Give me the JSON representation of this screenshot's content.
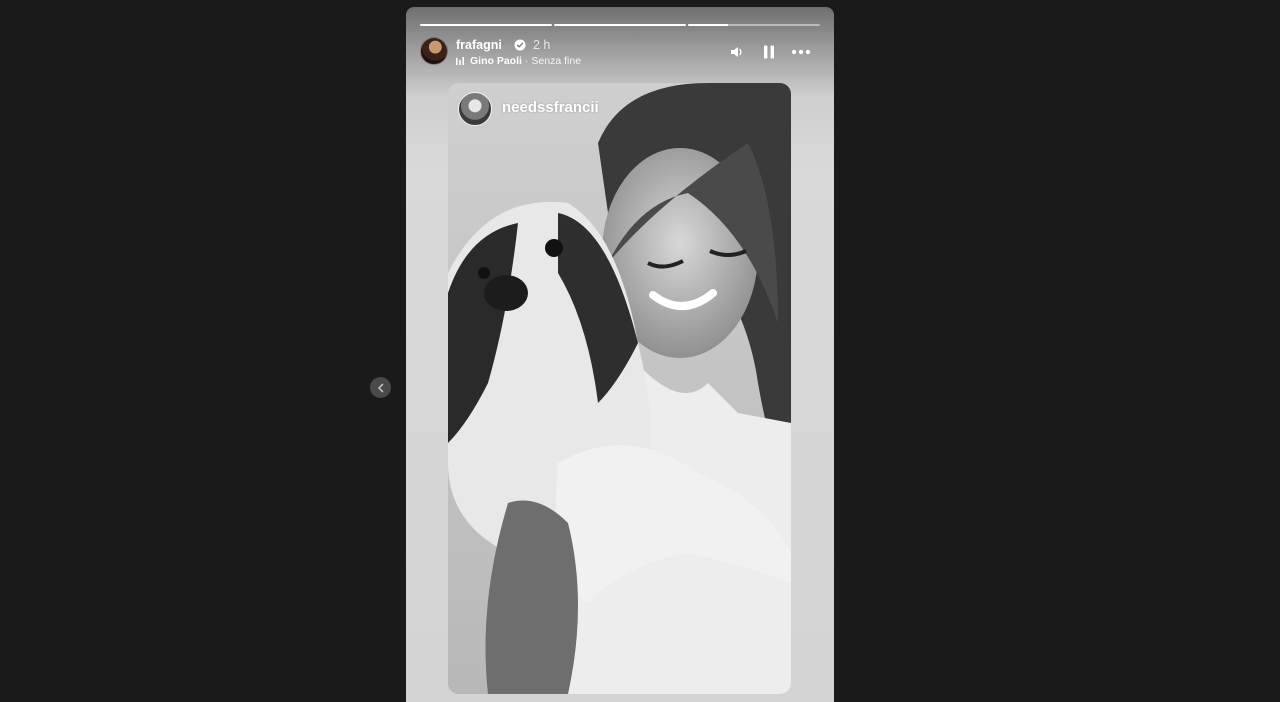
{
  "story": {
    "progress": [
      1.0,
      1.0,
      0.3
    ],
    "username": "frafagni",
    "time": "2 h",
    "music": {
      "artist": "Gino Paoli",
      "separator": "·",
      "track": "Senza fine"
    }
  },
  "shared_post": {
    "username": "needssfrancii"
  },
  "icons": {
    "prev": "chevron-left-icon",
    "volume": "speaker-icon",
    "pause": "pause-icon",
    "more": "more-horizontal-icon",
    "verified": "verified-badge-icon",
    "music": "music-bars-icon"
  }
}
